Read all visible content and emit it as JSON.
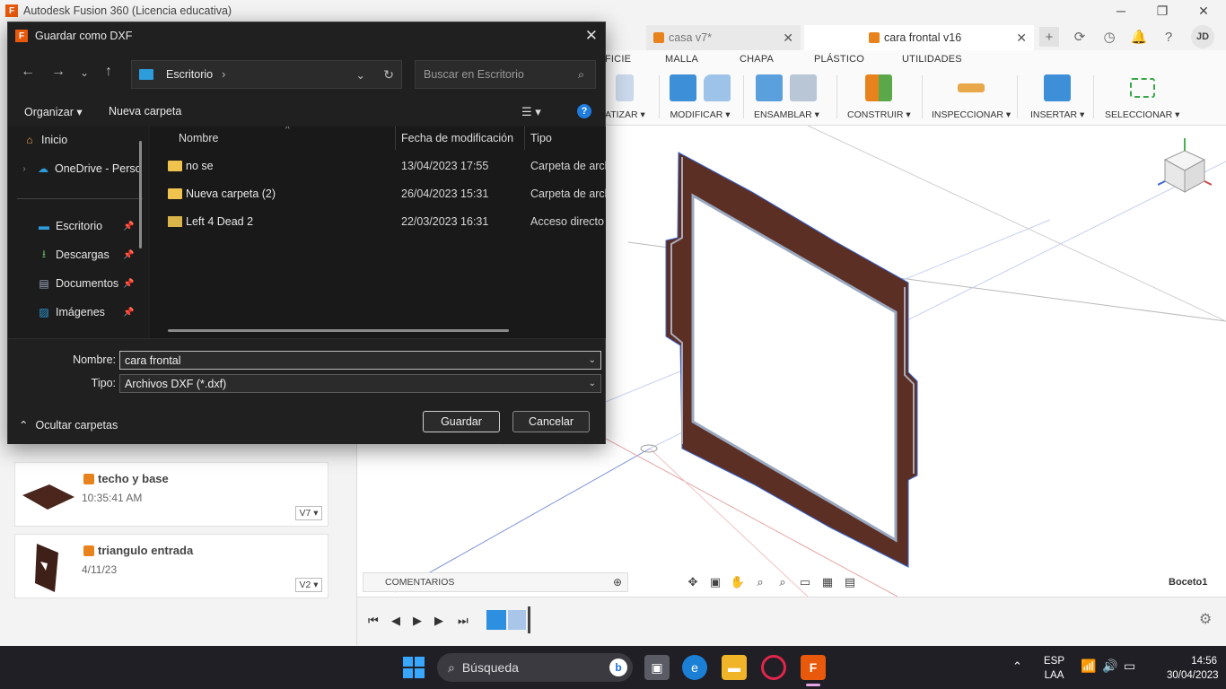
{
  "app": {
    "title": "Autodesk Fusion 360 (Licencia educativa)",
    "logo_letter": "F",
    "tabs": [
      {
        "label": "casa v7*",
        "active": false
      },
      {
        "label": "cara frontal v16",
        "active": true
      }
    ],
    "user_initials": "JD",
    "ribbon_tabs": [
      "FICIE",
      "MALLA",
      "CHAPA",
      "PLÁSTICO",
      "UTILIDADES"
    ],
    "ribbon_groups": [
      "ATIZAR ▾",
      "MODIFICAR ▾",
      "ENSAMBLAR ▾",
      "CONSTRUIR ▾",
      "INSPECCIONAR ▾",
      "INSERTAR ▾",
      "SELECCIONAR ▾"
    ],
    "comments_label": "COMENTARIOS",
    "sketch_label": "Boceto1",
    "data_cards": [
      {
        "name": "techo y base",
        "date": "10:35:41 AM",
        "version": "V7 ▾"
      },
      {
        "name": "triangulo entrada",
        "date": "4/11/23",
        "version": "V2 ▾"
      }
    ],
    "colors": {
      "accent": "#e8590c",
      "frame": "#5b2f24",
      "sketch_line": "#3a66d6"
    }
  },
  "dialog": {
    "title": "Guardar como DXF",
    "address": {
      "crumb": "Escritorio",
      "separator": "›"
    },
    "search_placeholder": "Buscar en Escritorio",
    "organize_label": "Organizar ▾",
    "new_folder_label": "Nueva carpeta",
    "nav_items": [
      {
        "label": "Inicio",
        "icon": "home-icon",
        "pinned": false
      },
      {
        "label": "OneDrive - Perso",
        "icon": "cloud-icon",
        "pinned": false
      },
      {
        "label": "Escritorio",
        "icon": "desktop-icon",
        "pinned": true
      },
      {
        "label": "Descargas",
        "icon": "download-icon",
        "pinned": true
      },
      {
        "label": "Documentos",
        "icon": "document-icon",
        "pinned": true
      },
      {
        "label": "Imágenes",
        "icon": "image-icon",
        "pinned": true
      }
    ],
    "columns": [
      "Nombre",
      "Fecha de modificación",
      "Tipo"
    ],
    "files": [
      {
        "name": "no se",
        "date": "13/04/2023 17:55",
        "type": "Carpeta de archi",
        "icon": "folder-icon"
      },
      {
        "name": "Nueva carpeta (2)",
        "date": "26/04/2023 15:31",
        "type": "Carpeta de archi",
        "icon": "folder-icon"
      },
      {
        "name": "Left 4 Dead 2",
        "date": "22/03/2023 16:31",
        "type": "Acceso directo a",
        "icon": "shortcut-icon"
      }
    ],
    "filename_label": "Nombre:",
    "filename_value": "cara frontal",
    "filetype_label": "Tipo:",
    "filetype_value": "Archivos DXF (*.dxf)",
    "hide_folders_label": "Ocultar carpetas",
    "save_label": "Guardar",
    "cancel_label": "Cancelar"
  },
  "taskbar": {
    "search_label": "Búsqueda",
    "lang_top": "ESP",
    "lang_bottom": "LAA",
    "time": "14:56",
    "date": "30/04/2023"
  }
}
